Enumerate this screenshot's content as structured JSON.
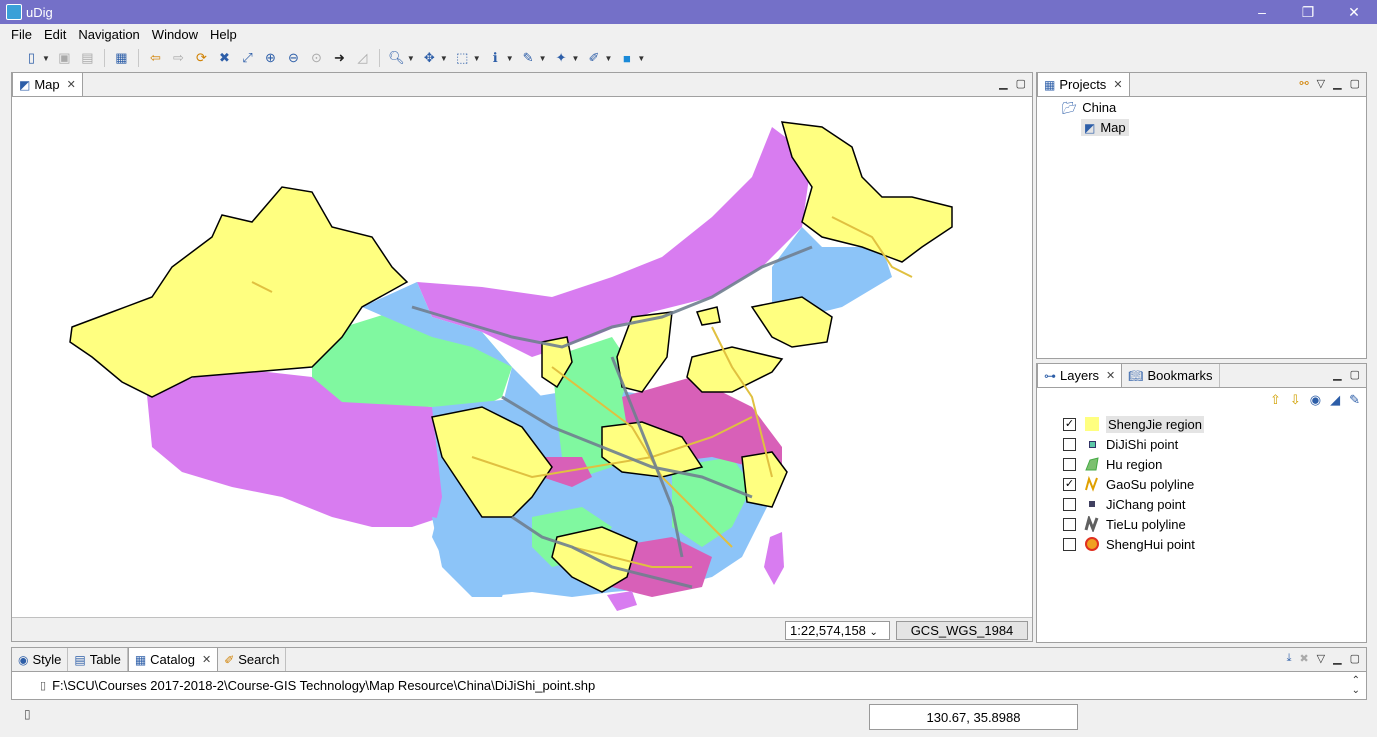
{
  "window": {
    "title": "uDig",
    "minimize": "–",
    "maximize": "❐",
    "close": "✕"
  },
  "menu": [
    "File",
    "Edit",
    "Navigation",
    "Window",
    "Help"
  ],
  "map_view": {
    "tab_label": "Map",
    "scale": "1:22,574,158",
    "crs": "GCS_WGS_1984"
  },
  "projects": {
    "tab_label": "Projects",
    "project": "China",
    "map": "Map"
  },
  "layers": {
    "tab_label": "Layers",
    "bookmarks_label": "Bookmarks",
    "items": [
      {
        "name": "ShengJie region",
        "checked": "✓",
        "color": "#ffff80"
      },
      {
        "name": "DiJiShi point",
        "checked": "",
        "color": "#5cc8a8"
      },
      {
        "name": "Hu region",
        "checked": "",
        "color": "#7cc070"
      },
      {
        "name": "GaoSu polyline",
        "checked": "✓",
        "color": "#e0a000"
      },
      {
        "name": "JiChang point",
        "checked": "",
        "color": "#404060"
      },
      {
        "name": "TieLu polyline",
        "checked": "",
        "color": "#606060"
      },
      {
        "name": "ShengHui point",
        "checked": "",
        "color": "#e03020"
      }
    ]
  },
  "bottom_tabs": {
    "style": "Style",
    "table": "Table",
    "catalog": "Catalog",
    "search": "Search",
    "path": "F:\\SCU\\Courses 2017-2018-2\\Course-GIS Technology\\Map Resource\\China\\DiJiShi_point.shp"
  },
  "status": {
    "coordinates": "130.67, 35.8988"
  },
  "colors": {
    "yellow": "#ffff80",
    "magenta": "#d87cf0",
    "blue": "#8cc4f8",
    "green": "#80f8a0",
    "pink": "#d860b8",
    "road": "#e0c040",
    "rail": "#708090"
  }
}
